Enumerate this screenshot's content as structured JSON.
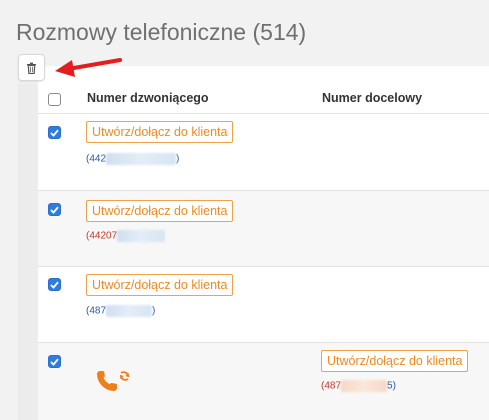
{
  "page": {
    "title": "Rozmowy telefoniczne (514)"
  },
  "toolbar": {
    "trash_icon": "trash-icon",
    "arrow_color": "#e41e1e"
  },
  "table": {
    "headers": {
      "caller": "Numer dzwoniącego",
      "target": "Numer docelowy"
    },
    "rows": [
      {
        "checked": true,
        "client_button": "Utwórz/dołącz do klienta",
        "number_prefix": "(442",
        "number_suffix": ")",
        "position": "caller"
      },
      {
        "checked": true,
        "client_button": "Utwórz/dołącz do klienta",
        "number_prefix": "(44207",
        "number_suffix": ")",
        "position": "caller"
      },
      {
        "checked": true,
        "client_button": "Utwórz/dołącz do klienta",
        "number_prefix": "(487",
        "number_suffix": ")",
        "position": "caller"
      },
      {
        "checked": true,
        "client_button": "Utwórz/dołącz do klienta",
        "number_prefix": "(487",
        "number_suffix": "5)",
        "position": "target",
        "call_icon": "phone-transfer-icon"
      }
    ]
  },
  "colors": {
    "accent_orange": "#ef8a22",
    "checkbox_blue": "#2f7ce0",
    "link_blue": "#2a5aa8"
  }
}
